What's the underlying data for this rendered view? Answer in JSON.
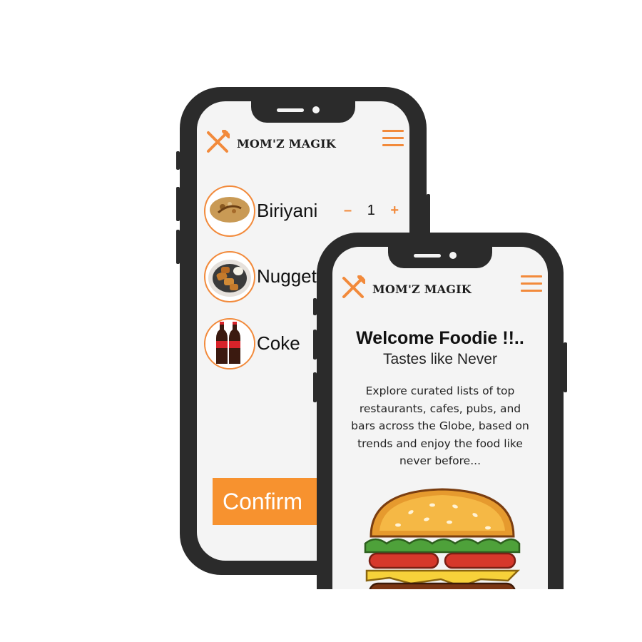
{
  "brand": {
    "name": "MOM'Z MAGIK"
  },
  "colors": {
    "accent": "#f28a3b",
    "button": "#f7922f",
    "frame": "#2b2b2b",
    "screen": "#f4f4f4"
  },
  "cart_screen": {
    "items": [
      {
        "name": "Biriyani",
        "quantity": "1",
        "minus_label": "–",
        "plus_label": "+",
        "icon": "biriyani-plate"
      },
      {
        "name": "Nuggets",
        "icon": "nuggets-plate"
      },
      {
        "name": "Coke",
        "icon": "coke-bottles"
      }
    ],
    "confirm_label": "Confirm"
  },
  "welcome_screen": {
    "title": "Welcome Foodie !!..",
    "subtitle": "Tastes like Never",
    "body": "Explore curated lists of top restaurants, cafes, pubs, and bars across the Globe, based on trends and enjoy the food like never before...",
    "hero_icon": "burger-illustration"
  }
}
